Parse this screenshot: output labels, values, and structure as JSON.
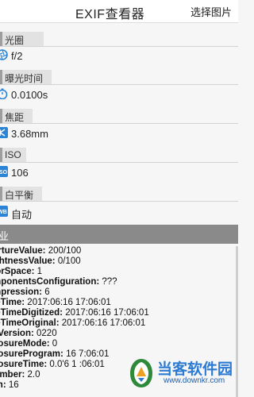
{
  "app": {
    "title": "EXIF查看器",
    "select_image": "选择图片"
  },
  "sections": {
    "aperture": {
      "label": "光圈",
      "value": "f/2",
      "icon": "aperture-icon"
    },
    "exposure_time": {
      "label": "曝光时间",
      "value": "0.0100s",
      "icon": "timer-icon"
    },
    "focal_length": {
      "label": "焦距",
      "value": "3.68mm",
      "icon": "focal-length-icon"
    },
    "iso": {
      "label": "ISO",
      "value": "106",
      "icon": "iso-icon"
    },
    "white_balance": {
      "label": "白平衡",
      "value": "自动",
      "icon": "white-balance-icon"
    }
  },
  "pro_bar": {
    "label": "业"
  },
  "details": [
    {
      "key": "pertureValue:",
      "value": "200/100"
    },
    {
      "key": "rightnessValue:",
      "value": "0/100"
    },
    {
      "key": "olorSpace:",
      "value": "1"
    },
    {
      "key": "omponentsConfiguration:",
      "value": "???"
    },
    {
      "key": "ompression:",
      "value": "6"
    },
    {
      "key": "ateTime:",
      "value": "2017:06:16 17:06:01"
    },
    {
      "key": "ateTimeDigitized:",
      "value": "2017:06:16 17:06:01"
    },
    {
      "key": "ateTimeOriginal:",
      "value": "2017:06:16 17:06:01"
    },
    {
      "key": "xifVersion:",
      "value": "0220"
    },
    {
      "key": "xposureMode:",
      "value": "0"
    },
    {
      "key": "xposureProgram:",
      "value": "16  7:06:01"
    },
    {
      "key": "xposureTime:",
      "value": "0.0'6 1 :06:01"
    },
    {
      "key": "Number:",
      "value": "2.0"
    },
    {
      "key": "ash:",
      "value": "16"
    }
  ],
  "watermark": {
    "title": "当客软件园",
    "url": "www.downkr.com"
  },
  "colors": {
    "accent_blue": "#2b84d6",
    "header_bg": "#e2e2e2",
    "dark_bar": "#8a8a8a"
  }
}
